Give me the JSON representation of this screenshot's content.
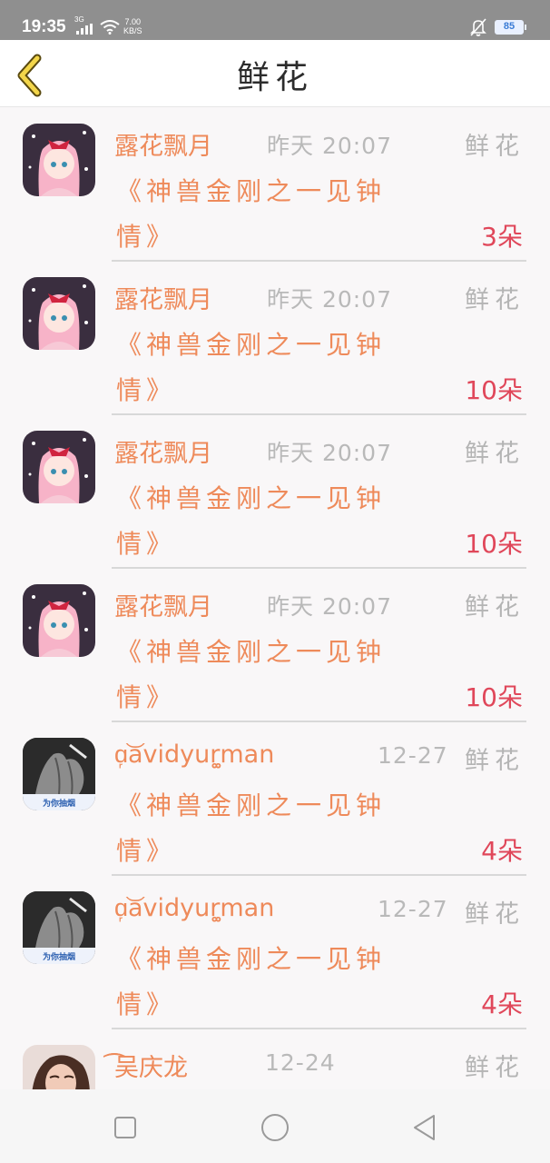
{
  "status_bar": {
    "time": "19:35",
    "network": "3G",
    "speed_value": "7.00",
    "speed_unit": "KB/S",
    "battery": "85",
    "icons": [
      "signal-icon",
      "wifi-icon",
      "mute-icon",
      "battery-icon"
    ]
  },
  "header": {
    "title": "鲜花",
    "back_icon": "chevron-left-icon"
  },
  "gifts": [
    {
      "user": "露花飘月",
      "time": "昨天 20:07",
      "kind": "鲜花",
      "book": "《神兽金刚之一见钟情》",
      "count": "3朵",
      "avatar": "pink-anime-girl"
    },
    {
      "user": "露花飘月",
      "time": "昨天 20:07",
      "kind": "鲜花",
      "book": "《神兽金刚之一见钟情》",
      "count": "10朵",
      "avatar": "pink-anime-girl"
    },
    {
      "user": "露花飘月",
      "time": "昨天 20:07",
      "kind": "鲜花",
      "book": "《神兽金刚之一见钟情》",
      "count": "10朵",
      "avatar": "pink-anime-girl"
    },
    {
      "user": "露花飘月",
      "time": "昨天 20:07",
      "kind": "鲜花",
      "book": "《神兽金刚之一见钟情》",
      "count": "10朵",
      "avatar": "pink-anime-girl"
    },
    {
      "user": "ɑ᷊͝avidyur͚͚man",
      "time": "12-27",
      "kind": "鲜花",
      "book": "《神兽金刚之一见钟情》",
      "count": "4朵",
      "avatar": "smoking-hand-photo",
      "avatar_caption": "为你抽烟"
    },
    {
      "user": "ɑ᷊͝avidyur͚͚man",
      "time": "12-27",
      "kind": "鲜花",
      "book": "《神兽金刚之一见钟情》",
      "count": "4朵",
      "avatar": "smoking-hand-photo",
      "avatar_caption": "为你抽烟"
    },
    {
      "user": "͡͡吴庆龙",
      "time": "12-24",
      "kind": "鲜花",
      "avatar": "woman-portrait-photo"
    }
  ],
  "colors": {
    "name": "#ee8a5a",
    "count": "#e0475a",
    "muted": "#b4b4b4",
    "status_bar": "#8f8f8f"
  },
  "nav_bar": {
    "icons": [
      "recent-apps-icon",
      "home-icon",
      "back-triangle-icon"
    ]
  }
}
